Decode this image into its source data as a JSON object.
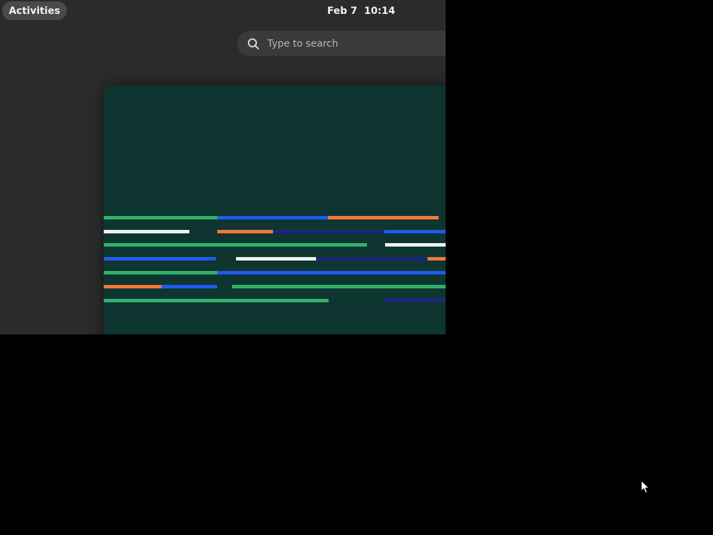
{
  "top_bar": {
    "activities_label": "Activities",
    "clock_text": "Feb 7  10:14"
  },
  "search": {
    "placeholder": "Type to search",
    "icon": "search-icon"
  },
  "window_preview": {
    "background_color": "#0e3530"
  },
  "colors": {
    "panel_background": "#2b2b2b",
    "screen_background": "#000000",
    "green": "#2db36a",
    "blue": "#1f5af0",
    "orange": "#f0783c",
    "white": "#f0f0f0",
    "navy": "#1a2680"
  },
  "cursor": {
    "icon": "arrow-cursor-icon"
  }
}
